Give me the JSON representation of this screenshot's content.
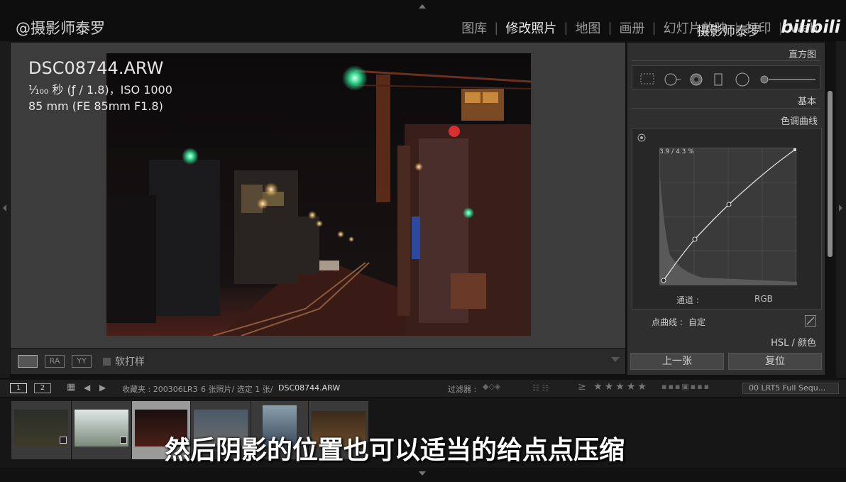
{
  "watermark": {
    "handle": "@摄影师泰罗",
    "overlay": "摄影师泰罗",
    "logo": "bilibili"
  },
  "modules": [
    "图库",
    "修改照片",
    "地图",
    "画册",
    "幻灯片放映",
    "打印",
    "Web"
  ],
  "active_module": "修改照片",
  "photo_info": {
    "filename": "DSC08744.ARW",
    "exposure": "¹⁄₁₀₀ 秒 (ƒ / 1.8)，ISO 1000",
    "lens": "85 mm (FE 85mm F1.8)"
  },
  "toolbar": {
    "soft_proof_label": "软打样",
    "ra_label": "RA",
    "yy_label": "YY"
  },
  "panel": {
    "histogram_label": "直方图",
    "basic_label": "基本",
    "tone_curve_label": "色调曲线",
    "point_value": "3.9 / 4.3 %",
    "channel_label": "通道 :",
    "channel_value": "RGB",
    "point_curve_label": "点曲线 :",
    "point_curve_value": "自定",
    "hsl_label": "HSL / 颜色",
    "prev_button": "上一张",
    "reset_button": "复位"
  },
  "filmstrip_bar": {
    "page1": "1",
    "page2": "2",
    "source": "收藏夹 : 200306LR3",
    "count": "6 张照片/ 选定 1 张/",
    "current_file": "DSC08744.ARW",
    "filter_label": "过滤器 :",
    "stars": "≥ ★★★★★",
    "preset": "00 LRT5 Full Sequ..."
  },
  "subtitle": "然后阴影的位置也可以适当的给点点压缩",
  "colors": {
    "accent_bg": "#2f2f2f",
    "view_bg": "#3c3c3c",
    "selected_thumb": "#9a9a9a"
  }
}
